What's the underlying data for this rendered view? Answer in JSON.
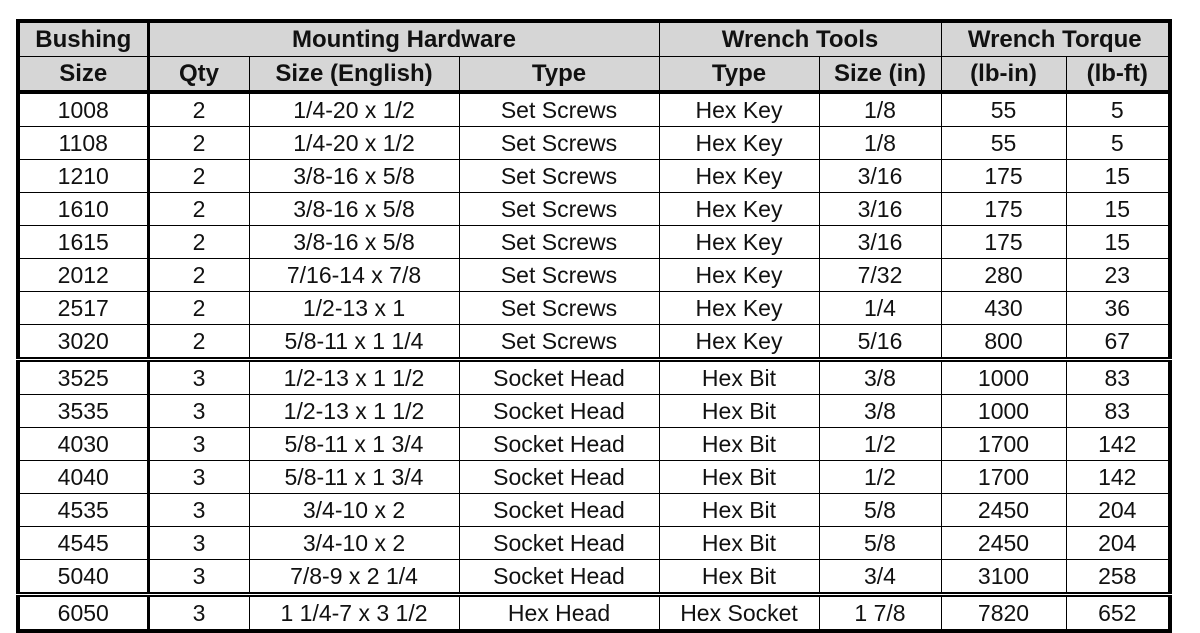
{
  "header": {
    "group_row": [
      {
        "label": "Bushing"
      },
      {
        "label": "Mounting Hardware"
      },
      {
        "label": "Wrench Tools"
      },
      {
        "label": "Wrench Torque"
      }
    ],
    "bushing_sub": "Size",
    "columns": [
      "Qty",
      "Size (English)",
      "Type",
      "Type",
      "Size (in)",
      "(lb-in)",
      "(lb-ft)"
    ]
  },
  "rows": [
    {
      "bushing": "1008",
      "qty": "2",
      "size": "1/4-20 x 1/2",
      "type": "Set Screws",
      "tool": "Hex Key",
      "tool_size": "1/8",
      "lb_in": "55",
      "lb_ft": "5",
      "group_start": false
    },
    {
      "bushing": "1108",
      "qty": "2",
      "size": "1/4-20 x 1/2",
      "type": "Set Screws",
      "tool": "Hex Key",
      "tool_size": "1/8",
      "lb_in": "55",
      "lb_ft": "5",
      "group_start": false
    },
    {
      "bushing": "1210",
      "qty": "2",
      "size": "3/8-16 x 5/8",
      "type": "Set Screws",
      "tool": "Hex Key",
      "tool_size": "3/16",
      "lb_in": "175",
      "lb_ft": "15",
      "group_start": false
    },
    {
      "bushing": "1610",
      "qty": "2",
      "size": "3/8-16 x 5/8",
      "type": "Set Screws",
      "tool": "Hex Key",
      "tool_size": "3/16",
      "lb_in": "175",
      "lb_ft": "15",
      "group_start": false
    },
    {
      "bushing": "1615",
      "qty": "2",
      "size": "3/8-16 x 5/8",
      "type": "Set Screws",
      "tool": "Hex Key",
      "tool_size": "3/16",
      "lb_in": "175",
      "lb_ft": "15",
      "group_start": false
    },
    {
      "bushing": "2012",
      "qty": "2",
      "size": "7/16-14 x 7/8",
      "type": "Set Screws",
      "tool": "Hex Key",
      "tool_size": "7/32",
      "lb_in": "280",
      "lb_ft": "23",
      "group_start": false
    },
    {
      "bushing": "2517",
      "qty": "2",
      "size": "1/2-13 x 1",
      "type": "Set Screws",
      "tool": "Hex Key",
      "tool_size": "1/4",
      "lb_in": "430",
      "lb_ft": "36",
      "group_start": false
    },
    {
      "bushing": "3020",
      "qty": "2",
      "size": "5/8-11 x 1 1/4",
      "type": "Set Screws",
      "tool": "Hex Key",
      "tool_size": "5/16",
      "lb_in": "800",
      "lb_ft": "67",
      "group_start": false
    },
    {
      "bushing": "3525",
      "qty": "3",
      "size": "1/2-13 x 1 1/2",
      "type": "Socket Head",
      "tool": "Hex Bit",
      "tool_size": "3/8",
      "lb_in": "1000",
      "lb_ft": "83",
      "group_start": true
    },
    {
      "bushing": "3535",
      "qty": "3",
      "size": "1/2-13 x 1 1/2",
      "type": "Socket Head",
      "tool": "Hex Bit",
      "tool_size": "3/8",
      "lb_in": "1000",
      "lb_ft": "83",
      "group_start": false
    },
    {
      "bushing": "4030",
      "qty": "3",
      "size": "5/8-11 x 1 3/4",
      "type": "Socket Head",
      "tool": "Hex Bit",
      "tool_size": "1/2",
      "lb_in": "1700",
      "lb_ft": "142",
      "group_start": false
    },
    {
      "bushing": "4040",
      "qty": "3",
      "size": "5/8-11 x 1 3/4",
      "type": "Socket Head",
      "tool": "Hex Bit",
      "tool_size": "1/2",
      "lb_in": "1700",
      "lb_ft": "142",
      "group_start": false
    },
    {
      "bushing": "4535",
      "qty": "3",
      "size": "3/4-10 x 2",
      "type": "Socket Head",
      "tool": "Hex Bit",
      "tool_size": "5/8",
      "lb_in": "2450",
      "lb_ft": "204",
      "group_start": false
    },
    {
      "bushing": "4545",
      "qty": "3",
      "size": "3/4-10 x 2",
      "type": "Socket Head",
      "tool": "Hex Bit",
      "tool_size": "5/8",
      "lb_in": "2450",
      "lb_ft": "204",
      "group_start": false
    },
    {
      "bushing": "5040",
      "qty": "3",
      "size": "7/8-9 x 2 1/4",
      "type": "Socket Head",
      "tool": "Hex Bit",
      "tool_size": "3/4",
      "lb_in": "3100",
      "lb_ft": "258",
      "group_start": false
    },
    {
      "bushing": "6050",
      "qty": "3",
      "size": "1 1/4-7 x 3 1/2",
      "type": "Hex Head",
      "tool": "Hex Socket",
      "tool_size": "1   7/8",
      "lb_in": "7820",
      "lb_ft": "652",
      "group_start": true
    }
  ]
}
